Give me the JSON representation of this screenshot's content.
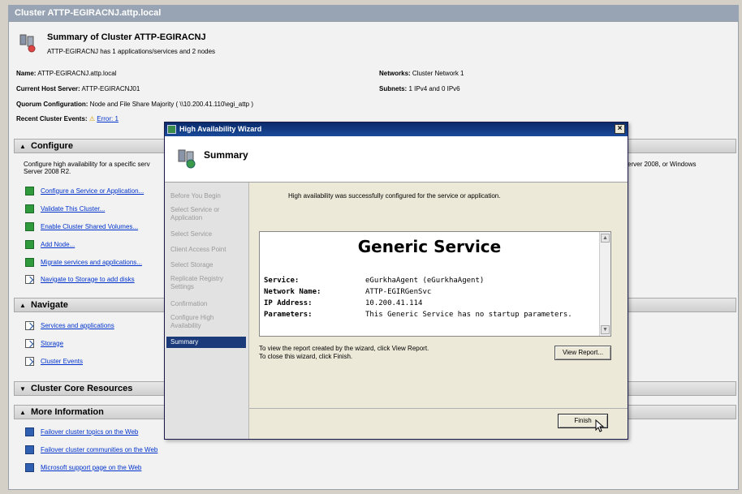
{
  "window": {
    "title": "Cluster ATTP-EGIRACNJ.attp.local"
  },
  "summary": {
    "title": "Summary of Cluster ATTP-EGIRACNJ",
    "subtitle": "ATTP-EGIRACNJ has 1 applications/services and 2 nodes"
  },
  "info": {
    "name_label": "Name:",
    "name_value": "ATTP-EGIRACNJ.attp.local",
    "host_label": "Current Host Server:",
    "host_value": "ATTP-EGIRACNJ01",
    "quorum_label": "Quorum Configuration:",
    "quorum_value": "Node and File Share Majority ( \\\\10.200.41.110\\egi_attp )",
    "events_label": "Recent Cluster Events:",
    "events_value": "Error: 1",
    "networks_label": "Networks:",
    "networks_value": "Cluster Network 1",
    "subnets_label": "Subnets:",
    "subnets_value": "1 IPv4 and 0 IPv6"
  },
  "configure": {
    "header": "Configure",
    "desc_left": "Configure high availability for a specific serv",
    "desc_left2": "Server 2008 R2.",
    "desc_right": "erver 2008, or Windows",
    "tasks": [
      "Configure a Service or Application...",
      "Validate This Cluster...",
      "Enable Cluster Shared Volumes...",
      "Add Node...",
      "Migrate services and applications...",
      "Navigate to Storage to add disks"
    ]
  },
  "navigate": {
    "header": "Navigate",
    "links": [
      "Services and applications",
      "Storage",
      "Cluster Events"
    ]
  },
  "core": {
    "header": "Cluster Core Resources"
  },
  "more": {
    "header": "More Information",
    "links": [
      "Failover cluster topics on the Web",
      "Failover cluster communities on the Web",
      "Microsoft support page on the Web"
    ]
  },
  "wizard": {
    "title": "High Availability Wizard",
    "header": "Summary",
    "nav": [
      "Before You Begin",
      "Select Service or Application",
      "Select Service",
      "Client Access Point",
      "Select Storage",
      "Replicate Registry Settings",
      "Confirmation",
      "Configure High Availability",
      "Summary"
    ],
    "success": "High availability was successfully configured for the service or application.",
    "report": {
      "title": "Generic Service",
      "rows": [
        {
          "k": "Service:",
          "v": "eGurkhaAgent (eGurkhaAgent)"
        },
        {
          "k": "Network Name:",
          "v": "ATTP-EGIRGenSvc"
        },
        {
          "k": "IP Address:",
          "v": "10.200.41.114"
        },
        {
          "k": "Parameters:",
          "v": "This Generic Service has no startup parameters."
        }
      ]
    },
    "view_text_1": "To view the report created by the wizard, click View Report.",
    "view_text_2": "To close this wizard, click Finish.",
    "view_report_btn": "View Report...",
    "finish_btn": "Finish"
  }
}
